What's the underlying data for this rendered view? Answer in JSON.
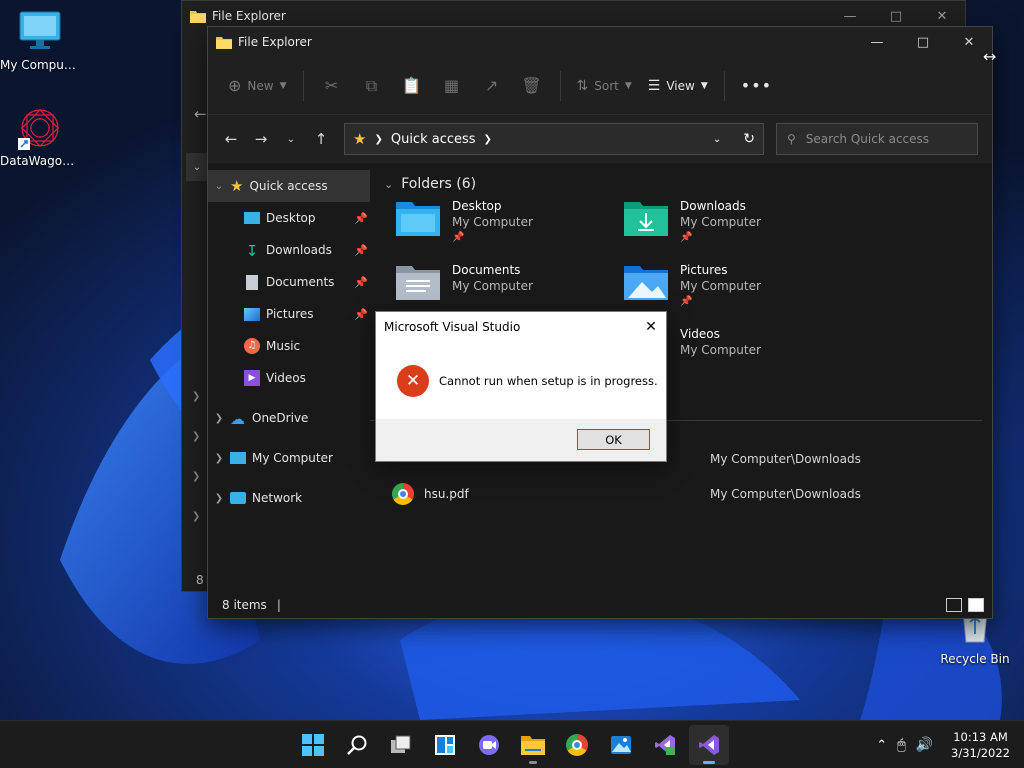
{
  "desktop": {
    "icons": [
      {
        "label": "My Computer"
      },
      {
        "label": "DataWagon..."
      },
      {
        "label": "Recycle Bin"
      }
    ]
  },
  "back_window": {
    "title": "File Explorer",
    "status_partial": "8 i"
  },
  "front_window": {
    "title": "File Explorer",
    "toolbar": {
      "new_label": "New",
      "sort_label": "Sort",
      "view_label": "View"
    },
    "address": {
      "current": "Quick access",
      "search_placeholder": "Search Quick access"
    },
    "nav_pane": {
      "quick_access": "Quick access",
      "items": [
        {
          "label": "Desktop",
          "pinned": true
        },
        {
          "label": "Downloads",
          "pinned": true
        },
        {
          "label": "Documents",
          "pinned": true
        },
        {
          "label": "Pictures",
          "pinned": true
        },
        {
          "label": "Music",
          "pinned": false
        },
        {
          "label": "Videos",
          "pinned": false
        }
      ],
      "roots": [
        {
          "label": "OneDrive"
        },
        {
          "label": "My Computer"
        },
        {
          "label": "Network"
        }
      ]
    },
    "folders_section": {
      "heading": "Folders (6)",
      "folders": [
        {
          "name": "Desktop",
          "location": "My Computer",
          "icon": "desktop-folder-icon"
        },
        {
          "name": "Downloads",
          "location": "My Computer",
          "icon": "downloads-folder-icon"
        },
        {
          "name": "Documents",
          "location": "My Computer",
          "icon": "documents-folder-icon"
        },
        {
          "name": "Pictures",
          "location": "My Computer",
          "icon": "pictures-folder-icon"
        },
        {
          "name": "Videos",
          "location": "My Computer",
          "icon": "videos-folder-icon"
        }
      ]
    },
    "recent_files": [
      {
        "name": "",
        "location": "My Computer\\Downloads"
      },
      {
        "name": "hsu.pdf",
        "location": "My Computer\\Downloads"
      }
    ],
    "status": {
      "items_count": "8 items"
    }
  },
  "dialog": {
    "title": "Microsoft Visual Studio",
    "message": "Cannot run when setup is in progress.",
    "ok_label": "OK"
  },
  "taskbar": {
    "apps": [
      "start",
      "search",
      "task-view",
      "widgets",
      "teams-chat",
      "file-explorer",
      "chrome",
      "photos",
      "visual-studio-installer",
      "visual-studio"
    ],
    "clock": {
      "time": "10:13 AM",
      "date": "3/31/2022"
    }
  },
  "colors": {
    "accent": "#60b4ff",
    "error": "#d93d1a",
    "folder_yellow": "#f5c542"
  }
}
